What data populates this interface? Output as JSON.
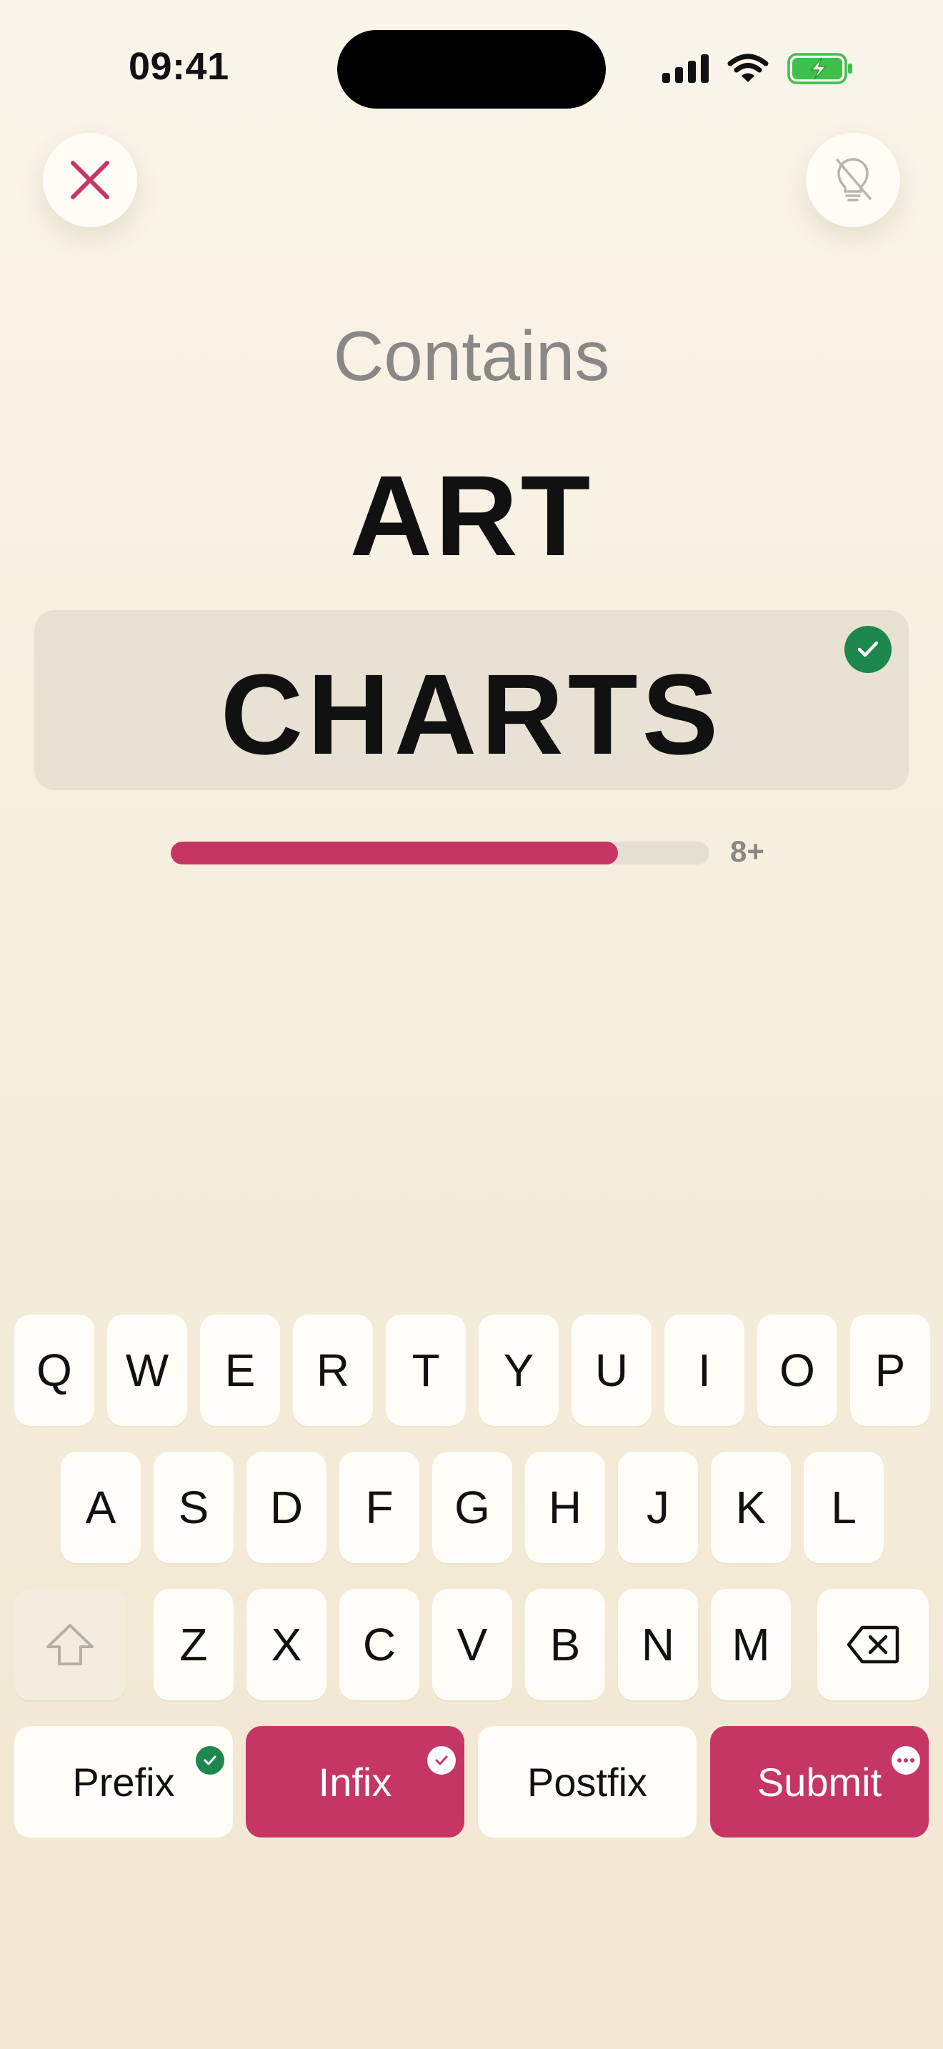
{
  "status_bar": {
    "time": "09:41"
  },
  "puzzle": {
    "label": "Contains",
    "fragment": "ART",
    "answer": "CHARTS",
    "answer_verified": true,
    "progress_fraction": 0.83,
    "progress_label": "8+"
  },
  "keyboard": {
    "row1": [
      "Q",
      "W",
      "E",
      "R",
      "T",
      "Y",
      "U",
      "I",
      "O",
      "P"
    ],
    "row2": [
      "A",
      "S",
      "D",
      "F",
      "G",
      "H",
      "J",
      "K",
      "L"
    ],
    "row3": [
      "Z",
      "X",
      "C",
      "V",
      "B",
      "N",
      "M"
    ]
  },
  "actions": {
    "prefix": "Prefix",
    "infix": "Infix",
    "postfix": "Postfix",
    "submit": "Submit"
  },
  "colors": {
    "accent": "#c63664",
    "success": "#1e874e",
    "muted_text": "#8a8884"
  },
  "icons": {
    "close": "close-icon",
    "hint_off": "lightbulb-slash-icon",
    "shift": "shift-arrow-icon",
    "backspace": "backspace-icon",
    "check": "checkmark-icon",
    "more": "ellipsis-icon"
  }
}
